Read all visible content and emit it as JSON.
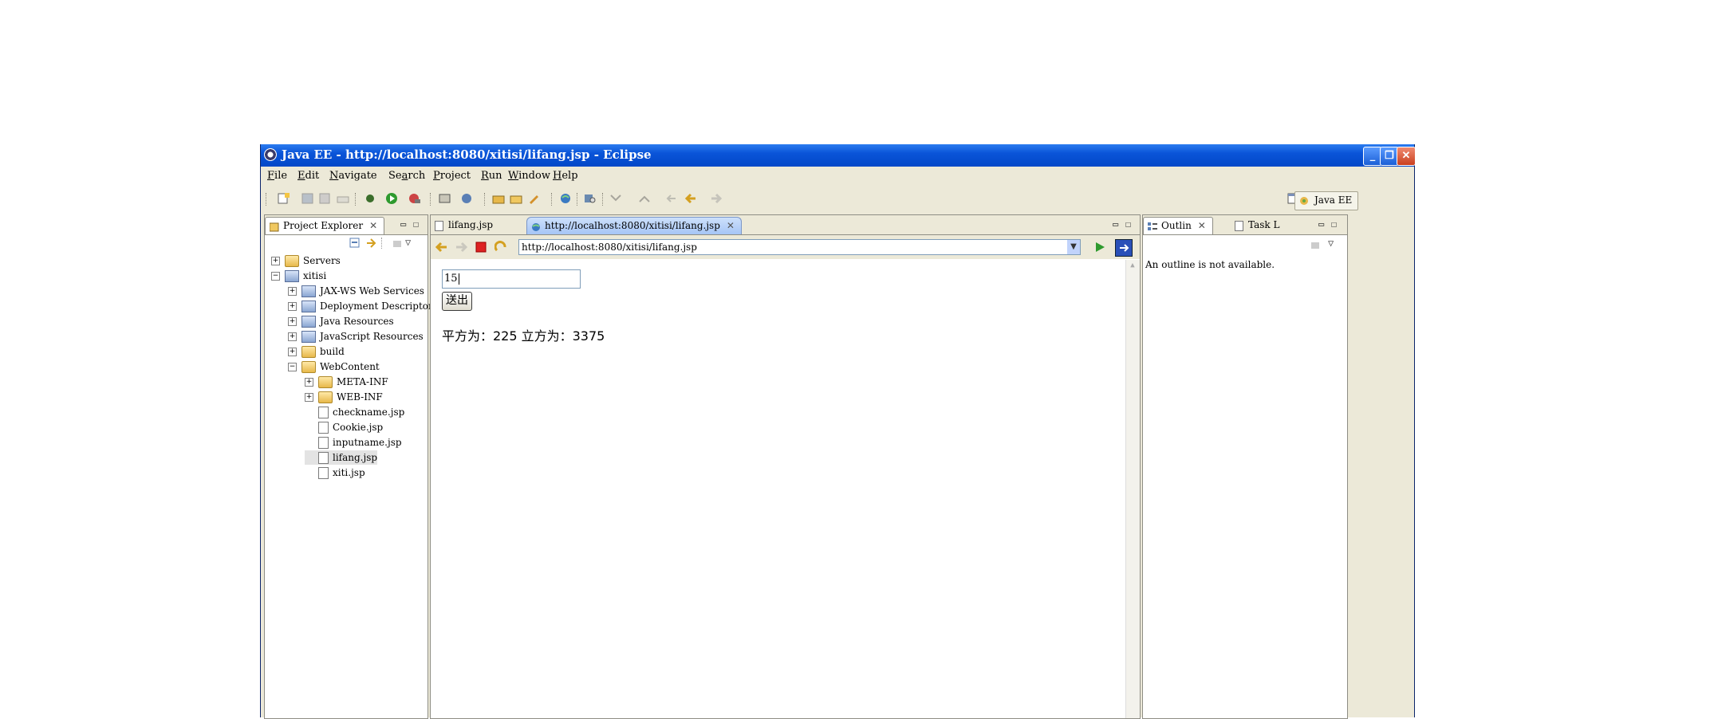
{
  "window": {
    "title": "Java EE - http://localhost:8080/xitisi/lifang.jsp - Eclipse",
    "controls": {
      "minimize": "_",
      "restore": "❐",
      "close": "✕"
    }
  },
  "menu": [
    {
      "key": "F",
      "rest": "ile"
    },
    {
      "key": "E",
      "rest": "dit"
    },
    {
      "key": "N",
      "rest": "avigate"
    },
    {
      "key": "",
      "pre": "Se",
      "key2": "a",
      "rest": "rch"
    },
    {
      "key": "P",
      "rest": "roject"
    },
    {
      "key": "R",
      "rest": "un"
    },
    {
      "key": "W",
      "rest": "indow"
    },
    {
      "key": "H",
      "rest": "elp"
    }
  ],
  "perspective": {
    "label": "Java EE"
  },
  "project_explorer": {
    "tab_label": "Project Explorer",
    "tree": [
      {
        "label": "Servers",
        "expander": "+",
        "indent": 0,
        "icon": "server-folder-icon"
      },
      {
        "label": "xitisi",
        "expander": "−",
        "indent": 0,
        "icon": "project-icon"
      },
      {
        "label": "JAX-WS Web Services",
        "expander": "+",
        "indent": 1,
        "icon": "webservice-icon"
      },
      {
        "label": "Deployment Descriptor: xitisi",
        "expander": "+",
        "indent": 1,
        "icon": "descriptor-icon"
      },
      {
        "label": "Java Resources",
        "expander": "+",
        "indent": 1,
        "icon": "java-resources-icon"
      },
      {
        "label": "JavaScript Resources",
        "expander": "+",
        "indent": 1,
        "icon": "javascript-resources-icon"
      },
      {
        "label": "build",
        "expander": "+",
        "indent": 1,
        "icon": "folder-icon"
      },
      {
        "label": "WebContent",
        "expander": "−",
        "indent": 1,
        "icon": "folder-open-icon"
      },
      {
        "label": "META-INF",
        "expander": "+",
        "indent": 2,
        "icon": "folder-icon"
      },
      {
        "label": "WEB-INF",
        "expander": "+",
        "indent": 2,
        "icon": "folder-icon"
      },
      {
        "label": "checkname.jsp",
        "expander": "",
        "indent": 2,
        "icon": "jsp-file-icon"
      },
      {
        "label": "Cookie.jsp",
        "expander": "",
        "indent": 2,
        "icon": "jsp-file-icon"
      },
      {
        "label": "inputname.jsp",
        "expander": "",
        "indent": 2,
        "icon": "jsp-file-icon"
      },
      {
        "label": "lifang.jsp",
        "expander": "",
        "indent": 2,
        "icon": "jsp-file-icon",
        "selected": true
      },
      {
        "label": "xiti.jsp",
        "expander": "",
        "indent": 2,
        "icon": "jsp-file-icon"
      }
    ]
  },
  "editor": {
    "tabs": [
      {
        "label": "lifang.jsp",
        "icon": "jsp-file-icon"
      },
      {
        "label": "http://localhost:8080/xitisi/lifang.jsp",
        "icon": "globe-icon",
        "active": true
      }
    ],
    "browser": {
      "url": "http://localhost:8080/xitisi/lifang.jsp",
      "input_value": "15",
      "submit_label": "送出",
      "result_text": "平方为：225 立方为：3375"
    }
  },
  "outline": {
    "tab_label": "Outlin",
    "task_tab_label": "Task L",
    "message": "An outline is not available."
  }
}
